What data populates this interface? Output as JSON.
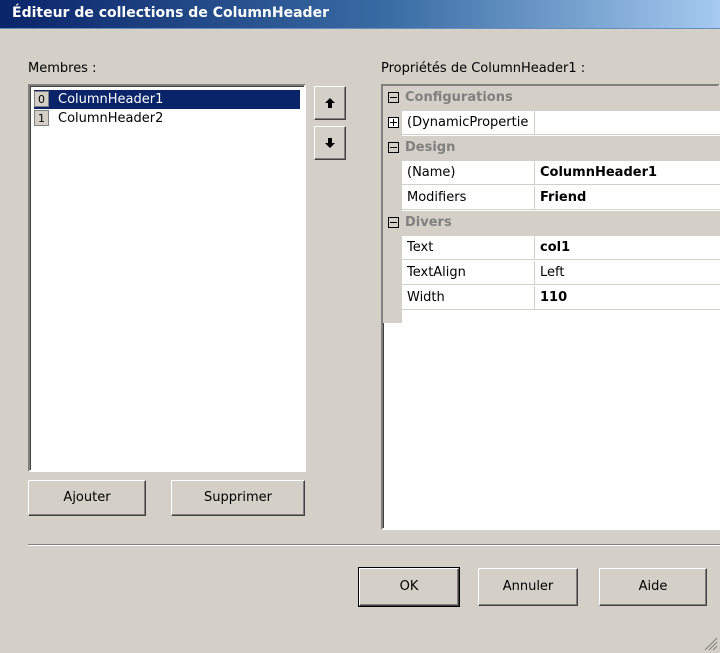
{
  "window": {
    "title": "Éditeur de collections de ColumnHeader"
  },
  "members": {
    "label": "Membres :",
    "items": [
      {
        "index": "0",
        "name": "ColumnHeader1",
        "selected": true
      },
      {
        "index": "1",
        "name": "ColumnHeader2",
        "selected": false
      }
    ],
    "move_up_icon": "arrow-up-icon",
    "move_down_icon": "arrow-down-icon",
    "add_label": "Ajouter",
    "remove_label": "Supprimer"
  },
  "properties": {
    "label": "Propriétés de ColumnHeader1 :",
    "categories": {
      "configurations": "Configurations",
      "design": "Design",
      "divers": "Divers"
    },
    "rows": {
      "dynamic": {
        "name": "(DynamicPropertie",
        "value": ""
      },
      "name": {
        "name": "(Name)",
        "value": "ColumnHeader1"
      },
      "modifiers": {
        "name": "Modifiers",
        "value": "Friend"
      },
      "text": {
        "name": "Text",
        "value": "col1"
      },
      "textalign": {
        "name": "TextAlign",
        "value": "Left"
      },
      "width": {
        "name": "Width",
        "value": "110"
      }
    }
  },
  "buttons": {
    "ok": "OK",
    "cancel": "Annuler",
    "help": "Aide"
  },
  "colors": {
    "title_bar": "#0a246a",
    "selection": "#0a246a",
    "dialog_bg": "#d4d0c8",
    "category_text": "#808080"
  }
}
